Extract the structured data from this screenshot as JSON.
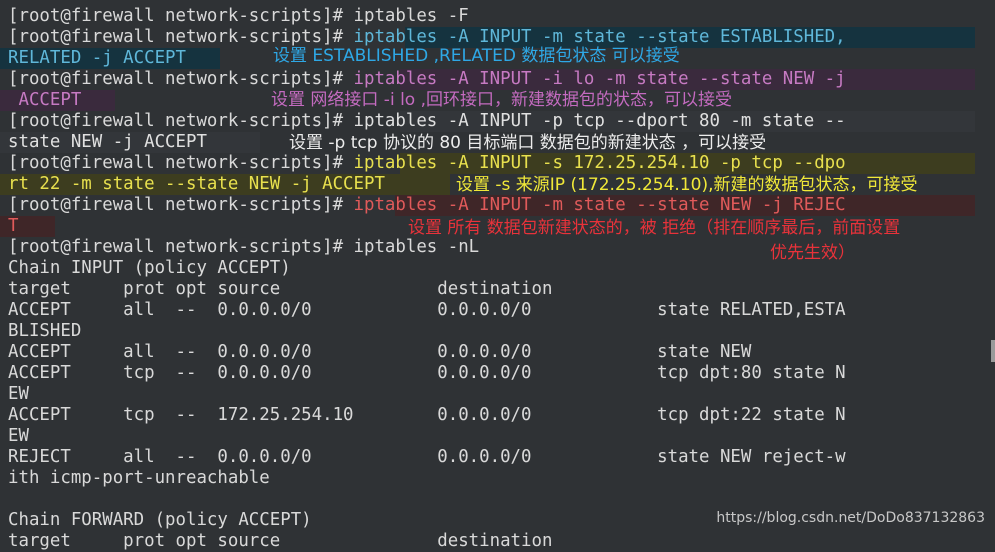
{
  "lines": [
    "[root@firewall network-scripts]# iptables -F",
    "[root@firewall network-scripts]# ",
    "iptables -A INPUT -m state --state ESTABLISHED,",
    "RELATED -j ACCEPT",
    "[root@firewall network-scripts]# ",
    "iptables -A INPUT -i lo -m state --state NEW -j",
    " ACCEPT",
    "[root@firewall network-scripts]# ",
    "iptables -A INPUT -p tcp --dport 80 -m state --",
    "state NEW -j ACCEPT",
    "[root@firewall network-scripts]# ",
    "iptables -A INPUT -s 172.25.254.10 -p tcp --dpo",
    "rt 22 -m state --state NEW -j ACCEPT",
    "[root@firewall network-scripts]# ",
    "iptables -A INPUT -m state --state NEW -j REJEC",
    "T",
    "[root@firewall network-scripts]# iptables -nL",
    "Chain INPUT (policy ACCEPT)",
    "target     prot opt source               destination",
    "ACCEPT     all  --  0.0.0.0/0            0.0.0.0/0            state RELATED,ESTA",
    "BLISHED",
    "ACCEPT     all  --  0.0.0.0/0            0.0.0.0/0            state NEW",
    "ACCEPT     tcp  --  0.0.0.0/0            0.0.0.0/0            tcp dpt:80 state N",
    "EW",
    "ACCEPT     tcp  --  172.25.254.10        0.0.0.0/0            tcp dpt:22 state N",
    "EW",
    "REJECT     all  --  0.0.0.0/0            0.0.0.0/0            state NEW reject-w",
    "ith icmp-port-unreachable",
    "",
    "Chain FORWARD (policy ACCEPT)",
    "target     prot opt source               destination"
  ],
  "notes": {
    "established": "设置 ESTABLISHED ,RELATED 数据包状态 可以接受",
    "loopback": "设置 网络接口 -i lo ,回环接口，新建数据包的状态，可以接受",
    "port80": "设置 -p tcp 协议的 80 目标端口 数据包的新建状态 ，可以接受",
    "source_ip": "设置 -s 来源IP (172.25.254.10),新建的数据包状态，可接受",
    "reject_line1": "设置 所有 数据包新建状态的，被 拒绝（排在顺序最后，前面设置",
    "reject_line2": "优先生效）"
  },
  "watermark": "https://blog.csdn.net/DoDo837132863"
}
